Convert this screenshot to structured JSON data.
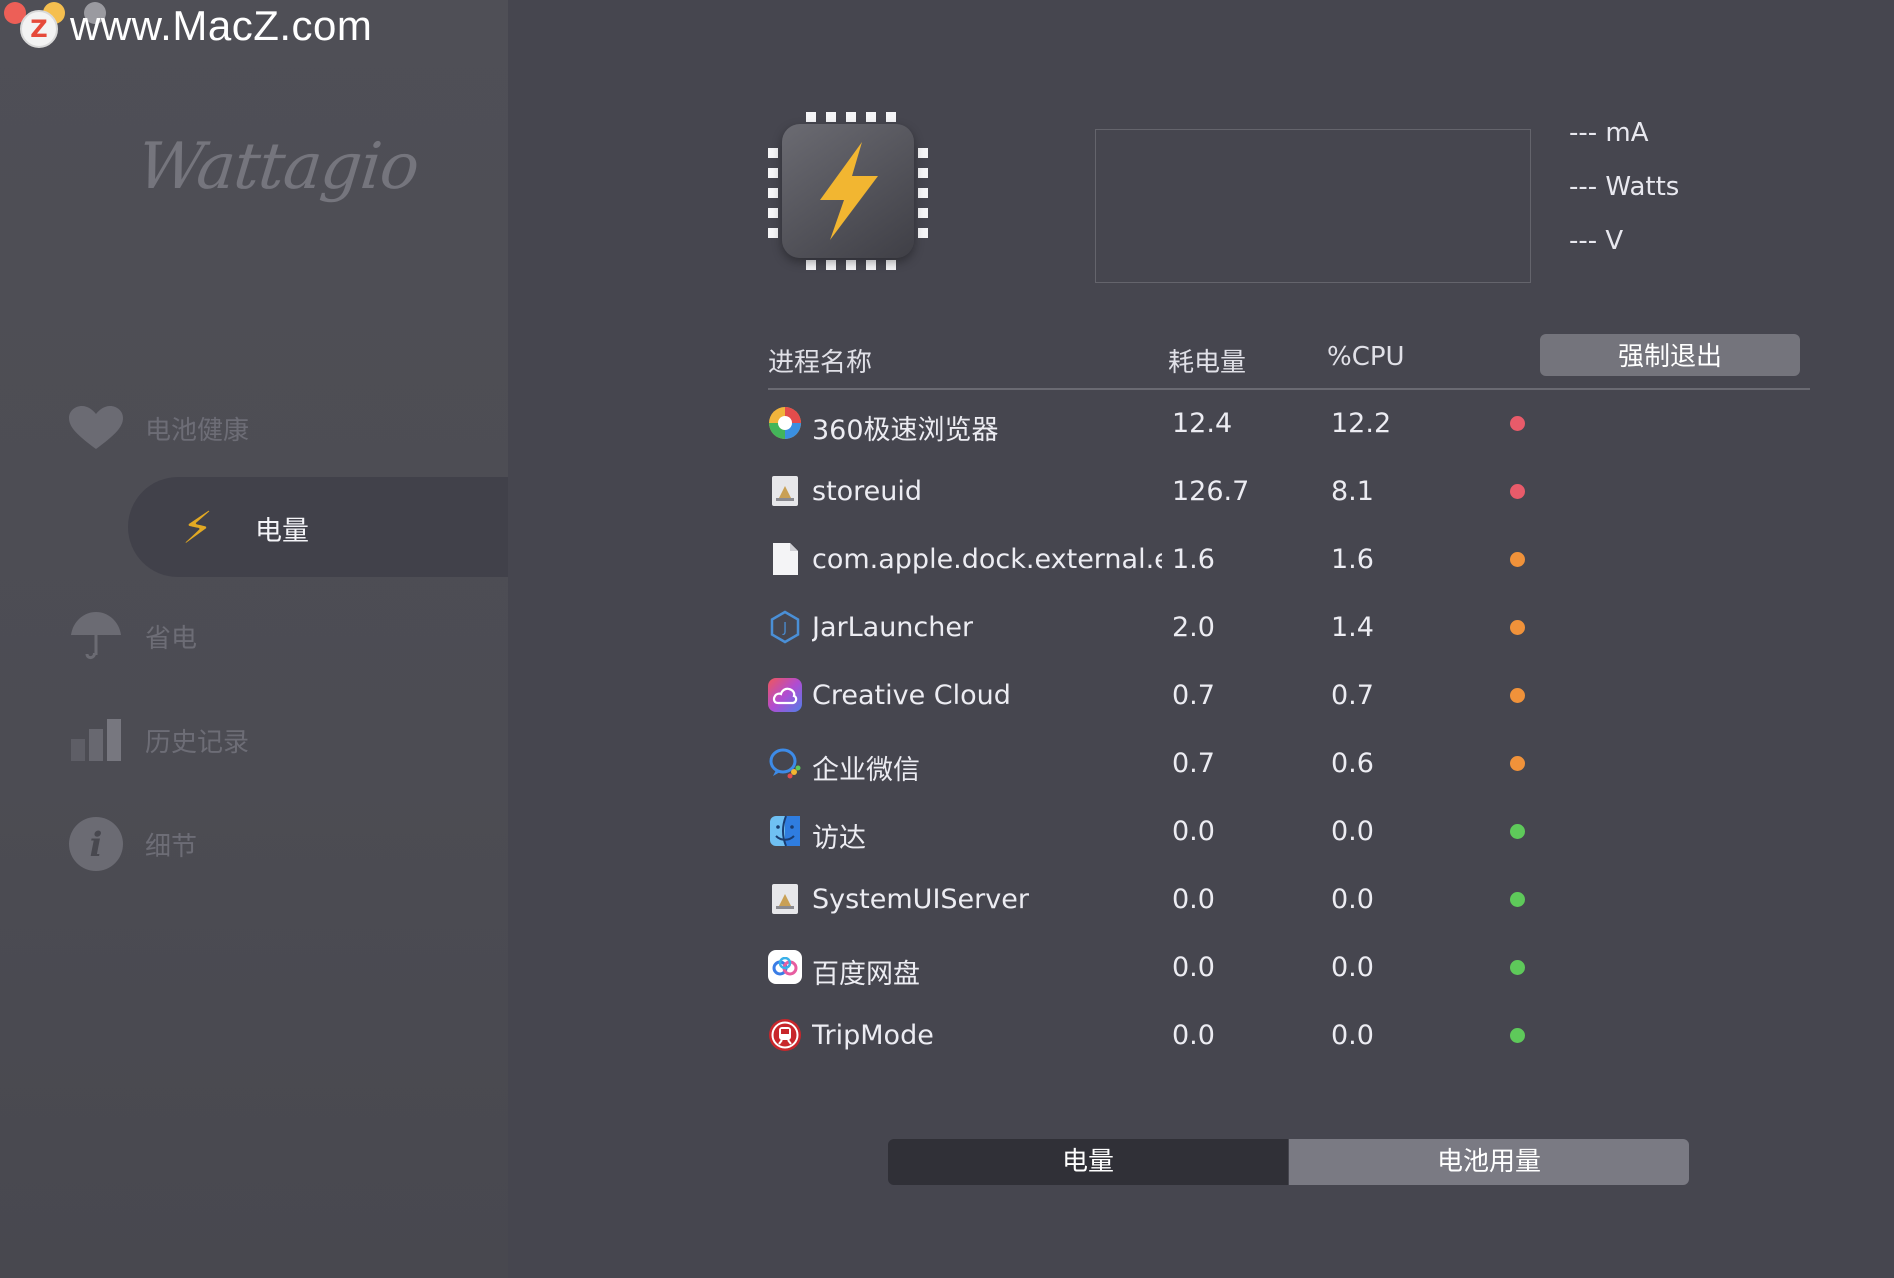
{
  "watermark": {
    "logo_letter": "Z",
    "text": "www.MacZ.com"
  },
  "app": {
    "name": "Wattagio"
  },
  "sidebar": {
    "items": [
      {
        "label": "电池健康",
        "icon": "heart-icon"
      },
      {
        "label": "电量",
        "icon": "bolt-icon",
        "active": true
      },
      {
        "label": "省电",
        "icon": "umbrella-icon"
      },
      {
        "label": "历史记录",
        "icon": "bar-chart-icon"
      },
      {
        "label": "细节",
        "icon": "info-icon"
      }
    ]
  },
  "readouts": {
    "current": "--- mA",
    "power": "--- Watts",
    "voltage": "--- V"
  },
  "table": {
    "headers": {
      "name": "进程名称",
      "power": "耗电量",
      "cpu": "%CPU"
    },
    "force_quit_label": "强制退出",
    "rows": [
      {
        "name": "360极速浏览器",
        "power": "12.4",
        "cpu": "12.2",
        "status": "high",
        "icon": "360-browser-icon"
      },
      {
        "name": "storeuid",
        "power": "126.7",
        "cpu": "8.1",
        "status": "high",
        "icon": "generic-app-icon"
      },
      {
        "name": "com.apple.dock.external.e...",
        "power": "1.6",
        "cpu": "1.6",
        "status": "medium",
        "icon": "document-icon"
      },
      {
        "name": "JarLauncher",
        "power": "2.0",
        "cpu": "1.4",
        "status": "medium",
        "icon": "jar-icon"
      },
      {
        "name": "Creative Cloud",
        "power": "0.7",
        "cpu": "0.7",
        "status": "medium",
        "icon": "creative-cloud-icon"
      },
      {
        "name": "企业微信",
        "power": "0.7",
        "cpu": "0.6",
        "status": "medium",
        "icon": "wecom-icon"
      },
      {
        "name": "访达",
        "power": "0.0",
        "cpu": "0.0",
        "status": "low",
        "icon": "finder-icon"
      },
      {
        "name": "SystemUIServer",
        "power": "0.0",
        "cpu": "0.0",
        "status": "low",
        "icon": "generic-app-icon"
      },
      {
        "name": "百度网盘",
        "power": "0.0",
        "cpu": "0.0",
        "status": "low",
        "icon": "baidu-netdisk-icon"
      },
      {
        "name": "TripMode",
        "power": "0.0",
        "cpu": "0.0",
        "status": "low",
        "icon": "tripmode-icon"
      }
    ]
  },
  "segmented": {
    "left_label": "电量",
    "right_label": "电池用量",
    "selected": "left"
  },
  "colors": {
    "status_high": "#e85b6a",
    "status_medium": "#f0923a",
    "status_low": "#5ec95a",
    "accent_bolt": "#f2b631"
  }
}
